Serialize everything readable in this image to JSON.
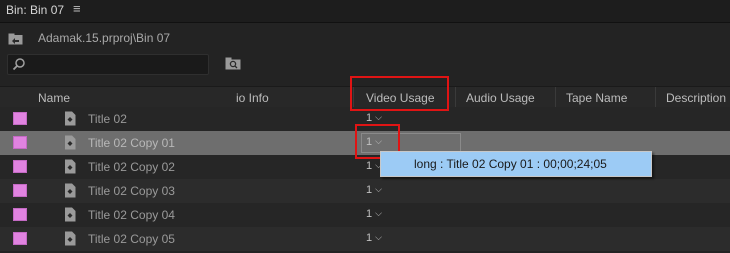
{
  "panel": {
    "title": "Bin: Bin 07",
    "menu_icon": "hamburger-icon"
  },
  "breadcrumb": {
    "path": "Adamak.15.prproj\\Bin 07",
    "icon": "up-folder-icon"
  },
  "search": {
    "icon": "search-icon",
    "value": "",
    "placeholder": ""
  },
  "toolbar": {
    "new_bin_icon": "new-bin-icon"
  },
  "columns": {
    "name": "Name",
    "audio_info": "io Info",
    "video_usage": "Video Usage",
    "audio_usage": "Audio Usage",
    "tape_name": "Tape Name",
    "description": "Description"
  },
  "rows": [
    {
      "name": "Title 02",
      "video_usage": "1",
      "label_color": "#e083e0",
      "selected": false
    },
    {
      "name": "Title 02 Copy 01",
      "video_usage": "1",
      "label_color": "#e083e0",
      "selected": true
    },
    {
      "name": "Title 02 Copy 02",
      "video_usage": "1",
      "label_color": "#e083e0",
      "selected": false
    },
    {
      "name": "Title 02 Copy 03",
      "video_usage": "1",
      "label_color": "#e083e0",
      "selected": false
    },
    {
      "name": "Title 02 Copy 04",
      "video_usage": "1",
      "label_color": "#e083e0",
      "selected": false
    },
    {
      "name": "Title 02 Copy 05",
      "video_usage": "1",
      "label_color": "#e083e0",
      "selected": false
    }
  ],
  "usage_tooltip": {
    "text": "long : Title 02 Copy 01 : 00;00;24;05"
  },
  "colors": {
    "background": "#232323",
    "selected_row": "#6e6e6e",
    "label": "#e083e0",
    "tooltip": "#9ccbf5",
    "annotation": "#e01414"
  }
}
